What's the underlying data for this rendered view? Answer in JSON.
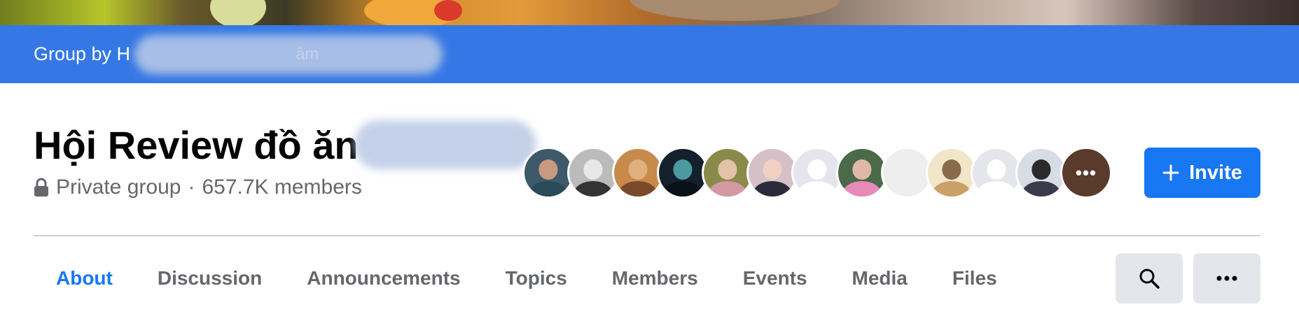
{
  "group_bar": {
    "prefix": "Group by H",
    "tail": "âm"
  },
  "group": {
    "title": "Hội Review đồ ăn",
    "privacy": "Private group",
    "separator": "·",
    "members": "657.7K members"
  },
  "members_preview": {
    "more": "•••"
  },
  "invite_label": "Invite",
  "tabs": [
    {
      "label": "About"
    },
    {
      "label": "Discussion"
    },
    {
      "label": "Announcements"
    },
    {
      "label": "Topics"
    },
    {
      "label": "Members"
    },
    {
      "label": "Events"
    },
    {
      "label": "Media"
    },
    {
      "label": "Files"
    }
  ],
  "colors": {
    "accent": "#1877f2",
    "bar": "#3578e5",
    "muted": "#65676b"
  },
  "icons": {
    "privacy": "lock-icon",
    "invite": "plus-icon",
    "search": "search-icon",
    "more": "more-horizontal-icon"
  }
}
